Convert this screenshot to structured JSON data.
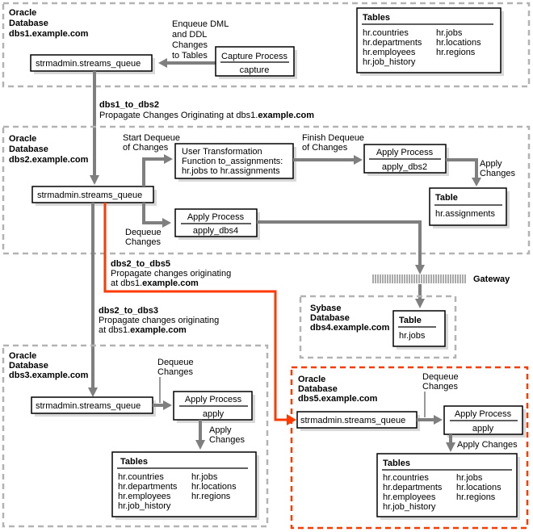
{
  "dbs1": {
    "title_line1": "Oracle",
    "title_line2": "Database",
    "title_line3": "dbs1.example.com",
    "queue": "strmadmin.streams_queue",
    "capture_header": "Capture Process",
    "capture_name": "capture",
    "enqueue_label": [
      "Enqueue DML",
      "and DDL",
      "Changes",
      "to Tables"
    ],
    "tables_header": "Tables",
    "tables_col1": [
      "hr.countries",
      "hr.departments",
      "hr.employees",
      "hr.job_history"
    ],
    "tables_col2": [
      "hr.jobs",
      "hr.locations",
      "hr.regions"
    ]
  },
  "prop_dbs1_to_dbs2": {
    "name": "dbs1_to_dbs2",
    "desc_prefix": "Propagate Changes Originating at dbs1.",
    "desc_bold": "example.com"
  },
  "dbs2": {
    "title_line1": "Oracle",
    "title_line2": "Database",
    "title_line3": "dbs2.example.com",
    "queue": "strmadmin.streams_queue",
    "start_dequeue": [
      "Start Dequeue",
      "of Changes"
    ],
    "transform": [
      "User Transformation",
      "Function to_assignments:",
      "hr.jobs to hr.assignments"
    ],
    "finish_dequeue": [
      "Finish Dequeue",
      "of Changes"
    ],
    "apply2_header": "Apply Process",
    "apply2_name": "apply_dbs2",
    "apply_changes": [
      "Apply",
      "Changes"
    ],
    "table_header": "Table",
    "table_name": "hr.assignments",
    "dequeue_changes": [
      "Dequeue",
      "Changes"
    ],
    "apply4_header": "Apply Process",
    "apply4_name": "apply_dbs4"
  },
  "prop_dbs2_to_dbs5": {
    "name": "dbs2_to_dbs5",
    "line1": "Propagate changes originating",
    "line2_prefix": "at dbs1.",
    "line2_bold": "example.com"
  },
  "prop_dbs2_to_dbs3": {
    "name": "dbs2_to_dbs3",
    "line1": "Propagate changes originating",
    "line2_prefix": "at dbs1.",
    "line2_bold": "example.com"
  },
  "gateway": {
    "label": "Gateway"
  },
  "dbs4": {
    "title_line1": "Sybase",
    "title_line2": "Database",
    "title_line3": "dbs4.example.com",
    "table_header": "Table",
    "table_name": "hr.jobs"
  },
  "dbs3": {
    "title_line1": "Oracle",
    "title_line2": "Database",
    "title_line3": "dbs3.example.com",
    "queue": "strmadmin.streams_queue",
    "dequeue_changes": [
      "Dequeue",
      "Changes"
    ],
    "apply_header": "Apply Process",
    "apply_name": "apply",
    "apply_changes": [
      "Apply",
      "Changes"
    ],
    "tables_header": "Tables",
    "tables_col1": [
      "hr.countries",
      "hr.departments",
      "hr.employees",
      "hr.job_history"
    ],
    "tables_col2": [
      "hr.jobs",
      "hr.locations",
      "hr.regions"
    ]
  },
  "dbs5": {
    "title_line1": "Oracle",
    "title_line2": "Database",
    "title_line3": "dbs5.example.com",
    "queue": "strmadmin.streams_queue",
    "dequeue_changes": [
      "Dequeue",
      "Changes"
    ],
    "apply_header": "Apply Process",
    "apply_name": "apply",
    "apply_changes": "Apply Changes",
    "tables_header": "Tables",
    "tables_col1": [
      "hr.countries",
      "hr.departments",
      "hr.employees",
      "hr.job_history"
    ],
    "tables_col2": [
      "hr.jobs",
      "hr.locations",
      "hr.regions"
    ]
  },
  "colors": {
    "highlight": "#ff3a00",
    "flow": "#7f7f7f",
    "region_border": "#b3b3b3"
  }
}
